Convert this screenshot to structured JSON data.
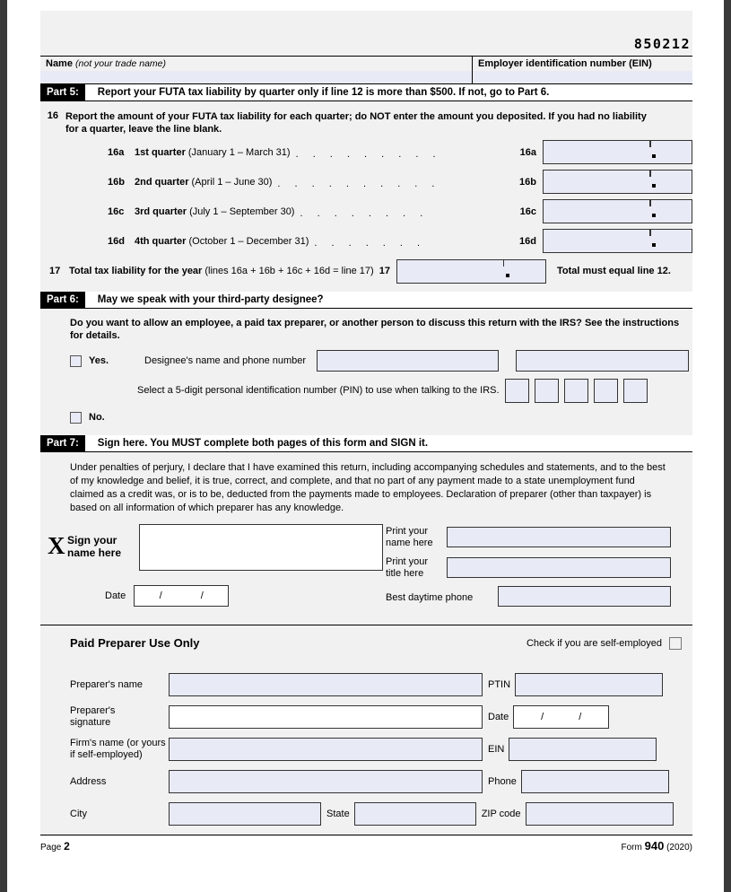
{
  "form_id": "850212",
  "header": {
    "name_label_bold": "Name",
    "name_label_italic": "(not your trade name)",
    "ein_label": "Employer identification number (EIN)"
  },
  "part5": {
    "tag": "Part 5:",
    "title": "Report your FUTA tax liability by quarter only if line 12 is more than $500. If not, go to Part 6.",
    "line16": {
      "number": "16",
      "text": "Report the amount of your FUTA tax liability for each quarter; do NOT enter the amount you deposited. If you had no liability for a quarter, leave the line blank.",
      "quarters": [
        {
          "code": "16a",
          "name": "1st quarter",
          "dates": "(January 1 – March 31)",
          "leader": ". . . . . . . . .",
          "ref": "16a"
        },
        {
          "code": "16b",
          "name": "2nd quarter",
          "dates": "(April 1 – June 30)",
          "leader": ". . . . . . . . . .",
          "ref": "16b"
        },
        {
          "code": "16c",
          "name": "3rd quarter",
          "dates": "(July 1 – September 30)",
          "leader": ". . . . . . . .",
          "ref": "16c"
        },
        {
          "code": "16d",
          "name": "4th quarter",
          "dates": "(October 1 – December 31)",
          "leader": ". . . . . . .",
          "ref": "16d"
        }
      ]
    },
    "line17": {
      "number": "17",
      "label_bold": "Total tax liability for the year",
      "label_paren": "(lines 16a + 16b + 16c + 16d = line 17)",
      "ref": "17",
      "note": "Total must equal line 12."
    }
  },
  "part6": {
    "tag": "Part 6:",
    "title": "May we speak with your third-party designee?",
    "question": "Do you want to allow an employee, a paid tax preparer, or another person to discuss this return with the IRS? See the instructions for details.",
    "yes_label": "Yes.",
    "designee_label": "Designee's name and phone number",
    "pin_label": "Select a 5-digit personal identification number (PIN) to use when talking to the IRS.",
    "pin_boxes": [
      "",
      "",
      "",
      "",
      ""
    ],
    "no_label": "No."
  },
  "part7": {
    "tag": "Part 7:",
    "title": "Sign here. You MUST complete both pages of this form and SIGN it.",
    "perjury": "Under penalties of perjury, I declare that I have examined this return, including accompanying schedules and statements, and to the best of my knowledge and belief, it is true, correct, and complete, and that no part of any payment made to a state unemployment fund claimed as a credit was, or is to be, deducted from the payments made to employees. Declaration of preparer (other than taxpayer) is based on all information of which preparer has any knowledge.",
    "x_glyph": "X",
    "sign_label": "Sign your\nname here",
    "sign_label_line1": "Sign your",
    "sign_label_line2": "name here",
    "date_label": "Date",
    "date_value": "/    /",
    "print_name_line1": "Print your",
    "print_name_line2": "name here",
    "print_title_line1": "Print your",
    "print_title_line2": "title here",
    "phone_label": "Best daytime phone"
  },
  "preparer": {
    "title": "Paid Preparer Use Only",
    "self_employed_label": "Check if you are self-employed",
    "name_label": "Preparer's name",
    "ptin_label": "PTIN",
    "signature_label_line1": "Preparer's",
    "signature_label_line2": "signature",
    "date_label": "Date",
    "date_value": "/    /",
    "firm_label_line1": "Firm's name (or yours",
    "firm_label_line2": "if self-employed)",
    "ein_label": "EIN",
    "address_label": "Address",
    "phone_label": "Phone",
    "city_label": "City",
    "state_label": "State",
    "zip_label": "ZIP code"
  },
  "footer": {
    "page_word": "Page",
    "page_number": "2",
    "form_word": "Form",
    "form_number": "940",
    "form_year": "(2020)"
  }
}
